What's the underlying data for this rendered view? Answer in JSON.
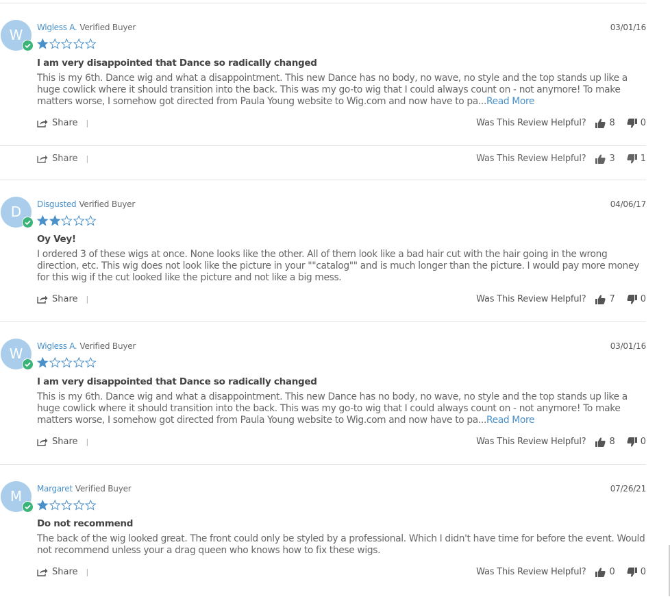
{
  "helpful_label": "Was This Review Helpful?",
  "share_label": "Share",
  "separator": "|",
  "read_more": "Read More",
  "verified_label": "Verified Buyer",
  "colors": {
    "accent": "#4a90c9",
    "avatar": "#a9cdea",
    "badge": "#3bb47a",
    "star": "#4a90c9"
  },
  "ghost_row": {
    "up": "3",
    "down": "1"
  },
  "reviews": [
    {
      "initial": "W",
      "name": "Wigless A.",
      "date": "03/01/16",
      "rating": 1,
      "title": "I am very disappointed that Dance so radically changed",
      "body": "This is my 6th. Dance wig and what a disappointment. This new Dance has no body, no wave, no style and the top stands up like a huge cowlick where it should transition into the back. This was my go-to wig that I could always count on - not anymore! To make matters worse, I somehow got directed from Paula Young website to Wig.com and now have to pa",
      "ellipsis": "...",
      "up": "8",
      "down": "0"
    },
    {
      "initial": "D",
      "name": "Disgusted",
      "date": "04/06/17",
      "rating": 2,
      "title": "Oy Vey!",
      "body": "I ordered 3 of these wigs at once. None looks like the other. All of them look like a bad hair cut with the hair going in the wrong direction, etc. This wig does not look like the picture in your \"\"catalog\"\" and is much longer than the picture. I would pay more money for this wig if the cut looked like the picture and not like a big mess.",
      "ellipsis": "",
      "up": "7",
      "down": "0"
    },
    {
      "initial": "W",
      "name": "Wigless A.",
      "date": "03/01/16",
      "rating": 1,
      "title": "I am very disappointed that Dance so radically changed",
      "body": "This is my 6th. Dance wig and what a disappointment. This new Dance has no body, no wave, no style and the top stands up like a huge cowlick where it should transition into the back. This was my go-to wig that I could always count on - not anymore! To make matters worse, I somehow got directed from Paula Young website to Wig.com and now have to pa",
      "ellipsis": "...",
      "up": "8",
      "down": "0"
    },
    {
      "initial": "M",
      "name": "Margaret",
      "date": "07/26/21",
      "rating": 1,
      "title": "Do not recommend",
      "body": "The back of the wig looked great. The front could only be styled by a professional. Which I didn't have time for before the event. Would not recommend unless your a drag queen who knows how to fix these wigs.",
      "ellipsis": "",
      "up": "0",
      "down": "0"
    }
  ]
}
